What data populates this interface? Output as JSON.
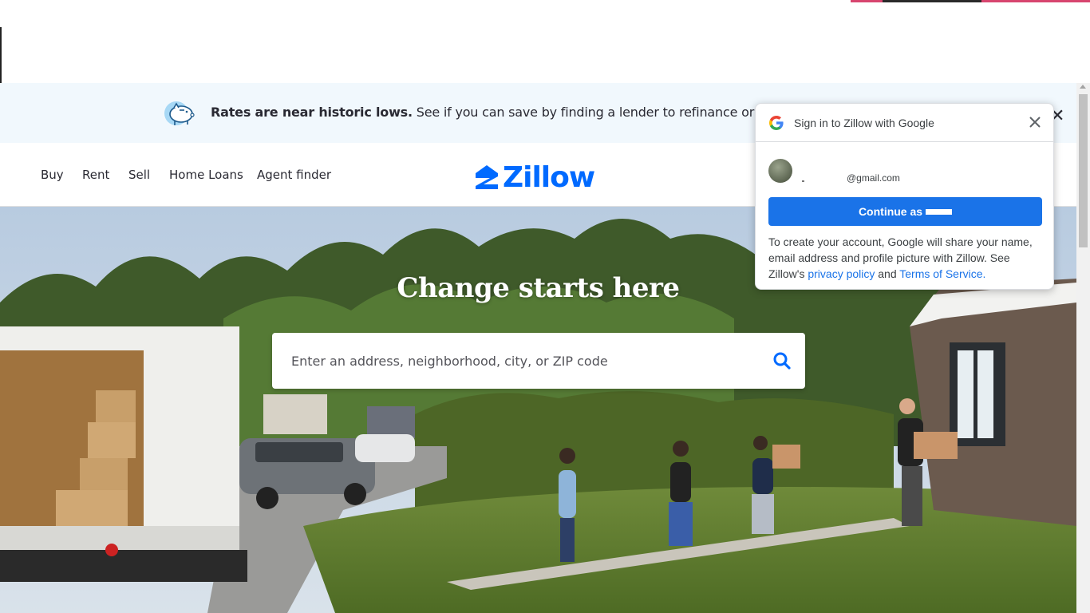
{
  "banner": {
    "bold_text": "Rates are near historic lows.",
    "text": " See if you can save by finding a lender to refinance or prepare"
  },
  "nav": {
    "items": [
      {
        "label": "Buy"
      },
      {
        "label": "Rent"
      },
      {
        "label": "Sell"
      },
      {
        "label": "Home Loans"
      },
      {
        "label": "Agent finder"
      }
    ],
    "logo_text": "Zillow",
    "brand_color": "#006aff"
  },
  "hero": {
    "headline": "Change starts here",
    "search_placeholder": "Enter an address, neighborhood, city, or ZIP code"
  },
  "google_popup": {
    "title": "Sign in to Zillow with Google",
    "email": "@gmail.com",
    "continue_label": "Continue as",
    "description_prefix": "To create your account, Google will share your name, email address and profile picture with Zillow. See Zillow's ",
    "privacy_link": "privacy policy",
    "and_text": " and ",
    "terms_link": "Terms of Service",
    "period": ".",
    "button_color": "#1a73e8"
  },
  "icons": {
    "banner": "piggy-bank-icon",
    "search": "search-icon",
    "close": "close-icon",
    "google": "google-g-icon"
  }
}
